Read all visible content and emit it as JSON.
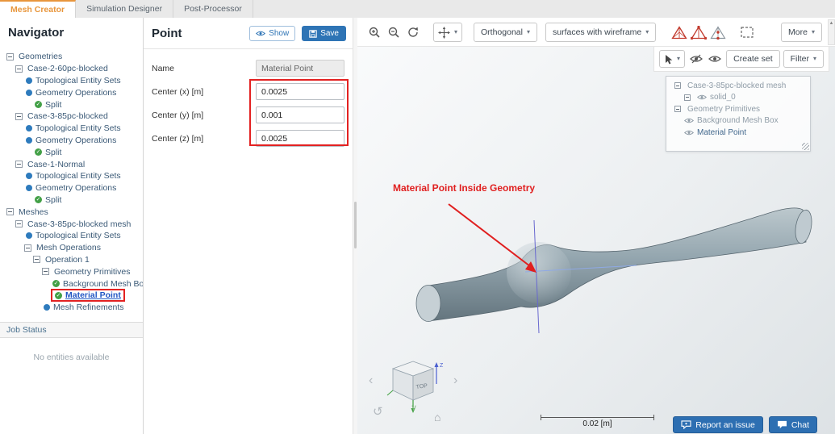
{
  "tabs": [
    {
      "label": "Mesh Creator",
      "active": true
    },
    {
      "label": "Simulation Designer",
      "active": false
    },
    {
      "label": "Post-Processor",
      "active": false
    }
  ],
  "navigator": {
    "title": "Navigator",
    "tree": [
      {
        "label": "Geometries",
        "level": 0,
        "expander": true
      },
      {
        "label": "Case-2-60pc-blocked",
        "level": 1,
        "expander": true
      },
      {
        "label": "Topological Entity Sets",
        "level": 2,
        "icon_dot": true
      },
      {
        "label": "Geometry Operations",
        "level": 2,
        "icon_dot": true
      },
      {
        "label": "Split",
        "level": 3,
        "icon_check": true
      },
      {
        "label": "Case-3-85pc-blocked",
        "level": 1,
        "expander": true
      },
      {
        "label": "Topological Entity Sets",
        "level": 2,
        "icon_dot": true
      },
      {
        "label": "Geometry Operations",
        "level": 2,
        "icon_dot": true
      },
      {
        "label": "Split",
        "level": 3,
        "icon_check": true
      },
      {
        "label": "Case-1-Normal",
        "level": 1,
        "expander": true
      },
      {
        "label": "Topological Entity Sets",
        "level": 2,
        "icon_dot": true
      },
      {
        "label": "Geometry Operations",
        "level": 2,
        "icon_dot": true
      },
      {
        "label": "Split",
        "level": 3,
        "icon_check": true
      },
      {
        "label": "Meshes",
        "level": 0,
        "expander": true
      },
      {
        "label": "Case-3-85pc-blocked mesh",
        "level": 1,
        "expander": true
      },
      {
        "label": "Topological Entity Sets",
        "level": 2,
        "icon_dot": true
      },
      {
        "label": "Mesh Operations",
        "level": 2,
        "expander": true
      },
      {
        "label": "Operation 1",
        "level": 3,
        "expander": true
      },
      {
        "label": "Geometry Primitives",
        "level": 4,
        "expander": true
      },
      {
        "label": "Background Mesh Box",
        "level": 5,
        "icon_check": true
      },
      {
        "label": "Material Point",
        "level": 5,
        "icon_check": true,
        "selected": true
      },
      {
        "label": "Mesh Refinements",
        "level": 4,
        "icon_dot": true
      }
    ],
    "job_status_label": "Job Status",
    "empty_message": "No entities available"
  },
  "properties": {
    "title": "Point",
    "show_label": "Show",
    "save_label": "Save",
    "fields": {
      "name": {
        "label": "Name",
        "value": "Material Point"
      },
      "center_x": {
        "label": "Center (x) [m]",
        "value": "0.0025"
      },
      "center_y": {
        "label": "Center (y) [m]",
        "value": "0.001"
      },
      "center_z": {
        "label": "Center (z) [m]",
        "value": "0.0025"
      }
    }
  },
  "viewport": {
    "toolbar": {
      "orthogonal_label": "Orthogonal",
      "render_mode_label": "surfaces with wireframe",
      "more_label": "More",
      "create_set_label": "Create set",
      "filter_label": "Filter"
    },
    "overlay_tree": [
      {
        "label": "Case-3-85pc-blocked mesh",
        "level": 0,
        "expander": true,
        "muted": true
      },
      {
        "label": "solid_0",
        "level": 1,
        "expander": true,
        "eye": true,
        "muted": true
      },
      {
        "label": "Geometry Primitives",
        "level": 0,
        "expander": true,
        "muted": true
      },
      {
        "label": "Background Mesh Box",
        "level": 1,
        "eye": true,
        "muted": true
      },
      {
        "label": "Material Point",
        "level": 1,
        "eye": true,
        "muted": false
      }
    ],
    "annotation": "Material Point Inside Geometry",
    "cube_label": "TOP",
    "axis_z_label": "Z",
    "scale_label": "0.02 [m]",
    "report_label": "Report an issue",
    "chat_label": "Chat"
  },
  "icons": {
    "caret_down": "▾",
    "chevron_left": "‹",
    "chevron_right": "›",
    "rotate_ccw": "↺",
    "chevron_down_small": "∨",
    "home": "⌂",
    "check": "✓",
    "scroll_up": "▲"
  },
  "colors": {
    "accent_blue": "#2e74b5",
    "tab_active_orange": "#e8963c",
    "highlight_red": "#e32222",
    "tree_blue": "#3b5a77",
    "check_green": "#43a047",
    "dot_blue": "#2e7bbd"
  }
}
